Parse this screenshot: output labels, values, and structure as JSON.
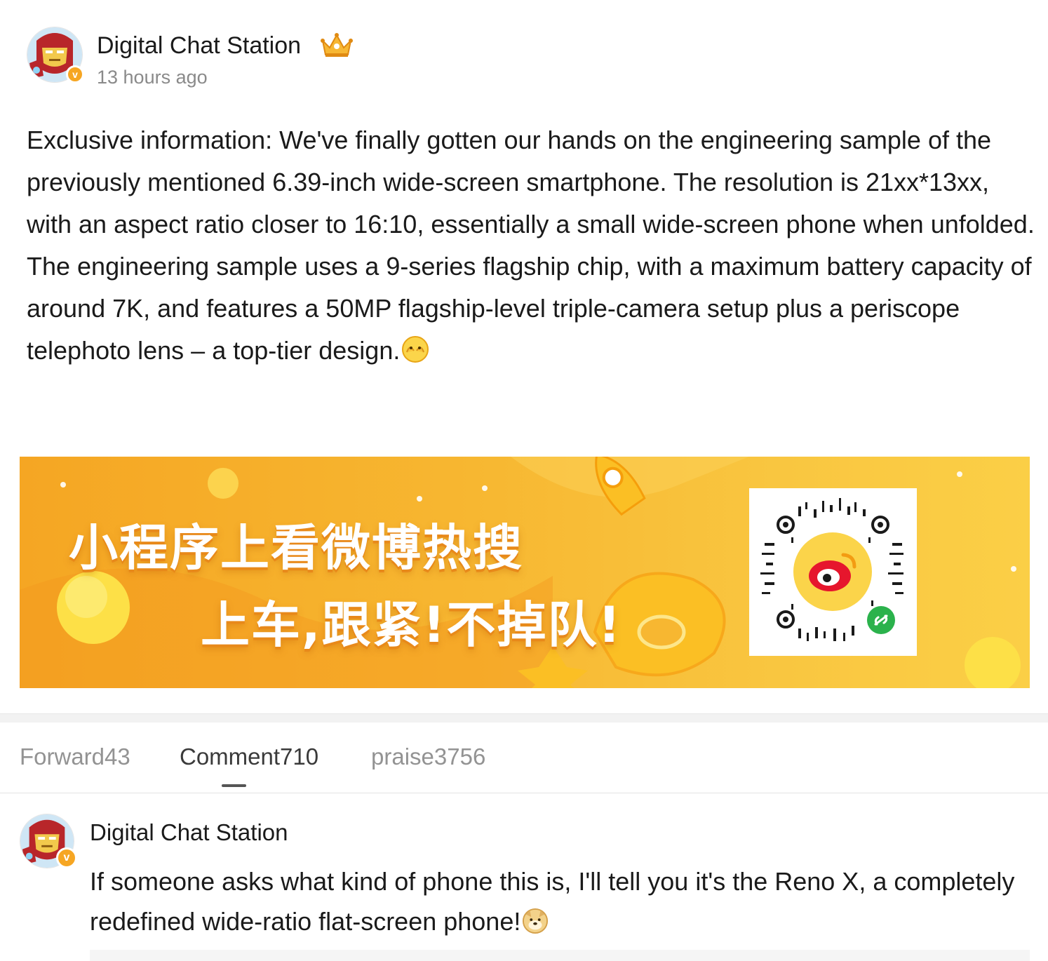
{
  "post": {
    "author": "Digital Chat Station",
    "author_badge_icon": "crown-icon",
    "verified_badge": "v",
    "timestamp": "13 hours ago",
    "paragraph1": "Exclusive information: We've finally gotten our hands on the engineering sample of the previously mentioned 6.39-inch wide-screen smartphone. The resolution is 21xx*13xx, with an aspect ratio closer to 16:10, essentially a small wide-screen phone when unfolded.",
    "paragraph2": "The engineering sample uses a 9-series flagship chip, with a maximum battery capacity of around 7K, and features a 50MP flagship-level triple-camera setup plus a periscope telephoto lens – a top-tier design.",
    "paragraph2_emoji": "peeking-face-emoji"
  },
  "banner": {
    "line1": "小程序上看微博热搜",
    "line2": "上车,跟紧!不掉队!",
    "qr_icon": "qr-code-icon",
    "colors": {
      "start": "#f5a623",
      "end": "#fbcf46"
    }
  },
  "tabs": [
    {
      "label": "Forward43",
      "active": false
    },
    {
      "label": "Comment710",
      "active": true
    },
    {
      "label": "praise3756",
      "active": false
    }
  ],
  "comment": {
    "author": "Digital Chat Station",
    "verified_badge": "v",
    "text": "If someone asks what kind of phone this is, I'll tell you it's the Reno X, a completely redefined wide-ratio flat-screen phone!",
    "emoji": "doge-emoji"
  },
  "colors": {
    "text": "#1a1a1a",
    "muted": "#8a8a8a",
    "verified": "#f6a623"
  }
}
